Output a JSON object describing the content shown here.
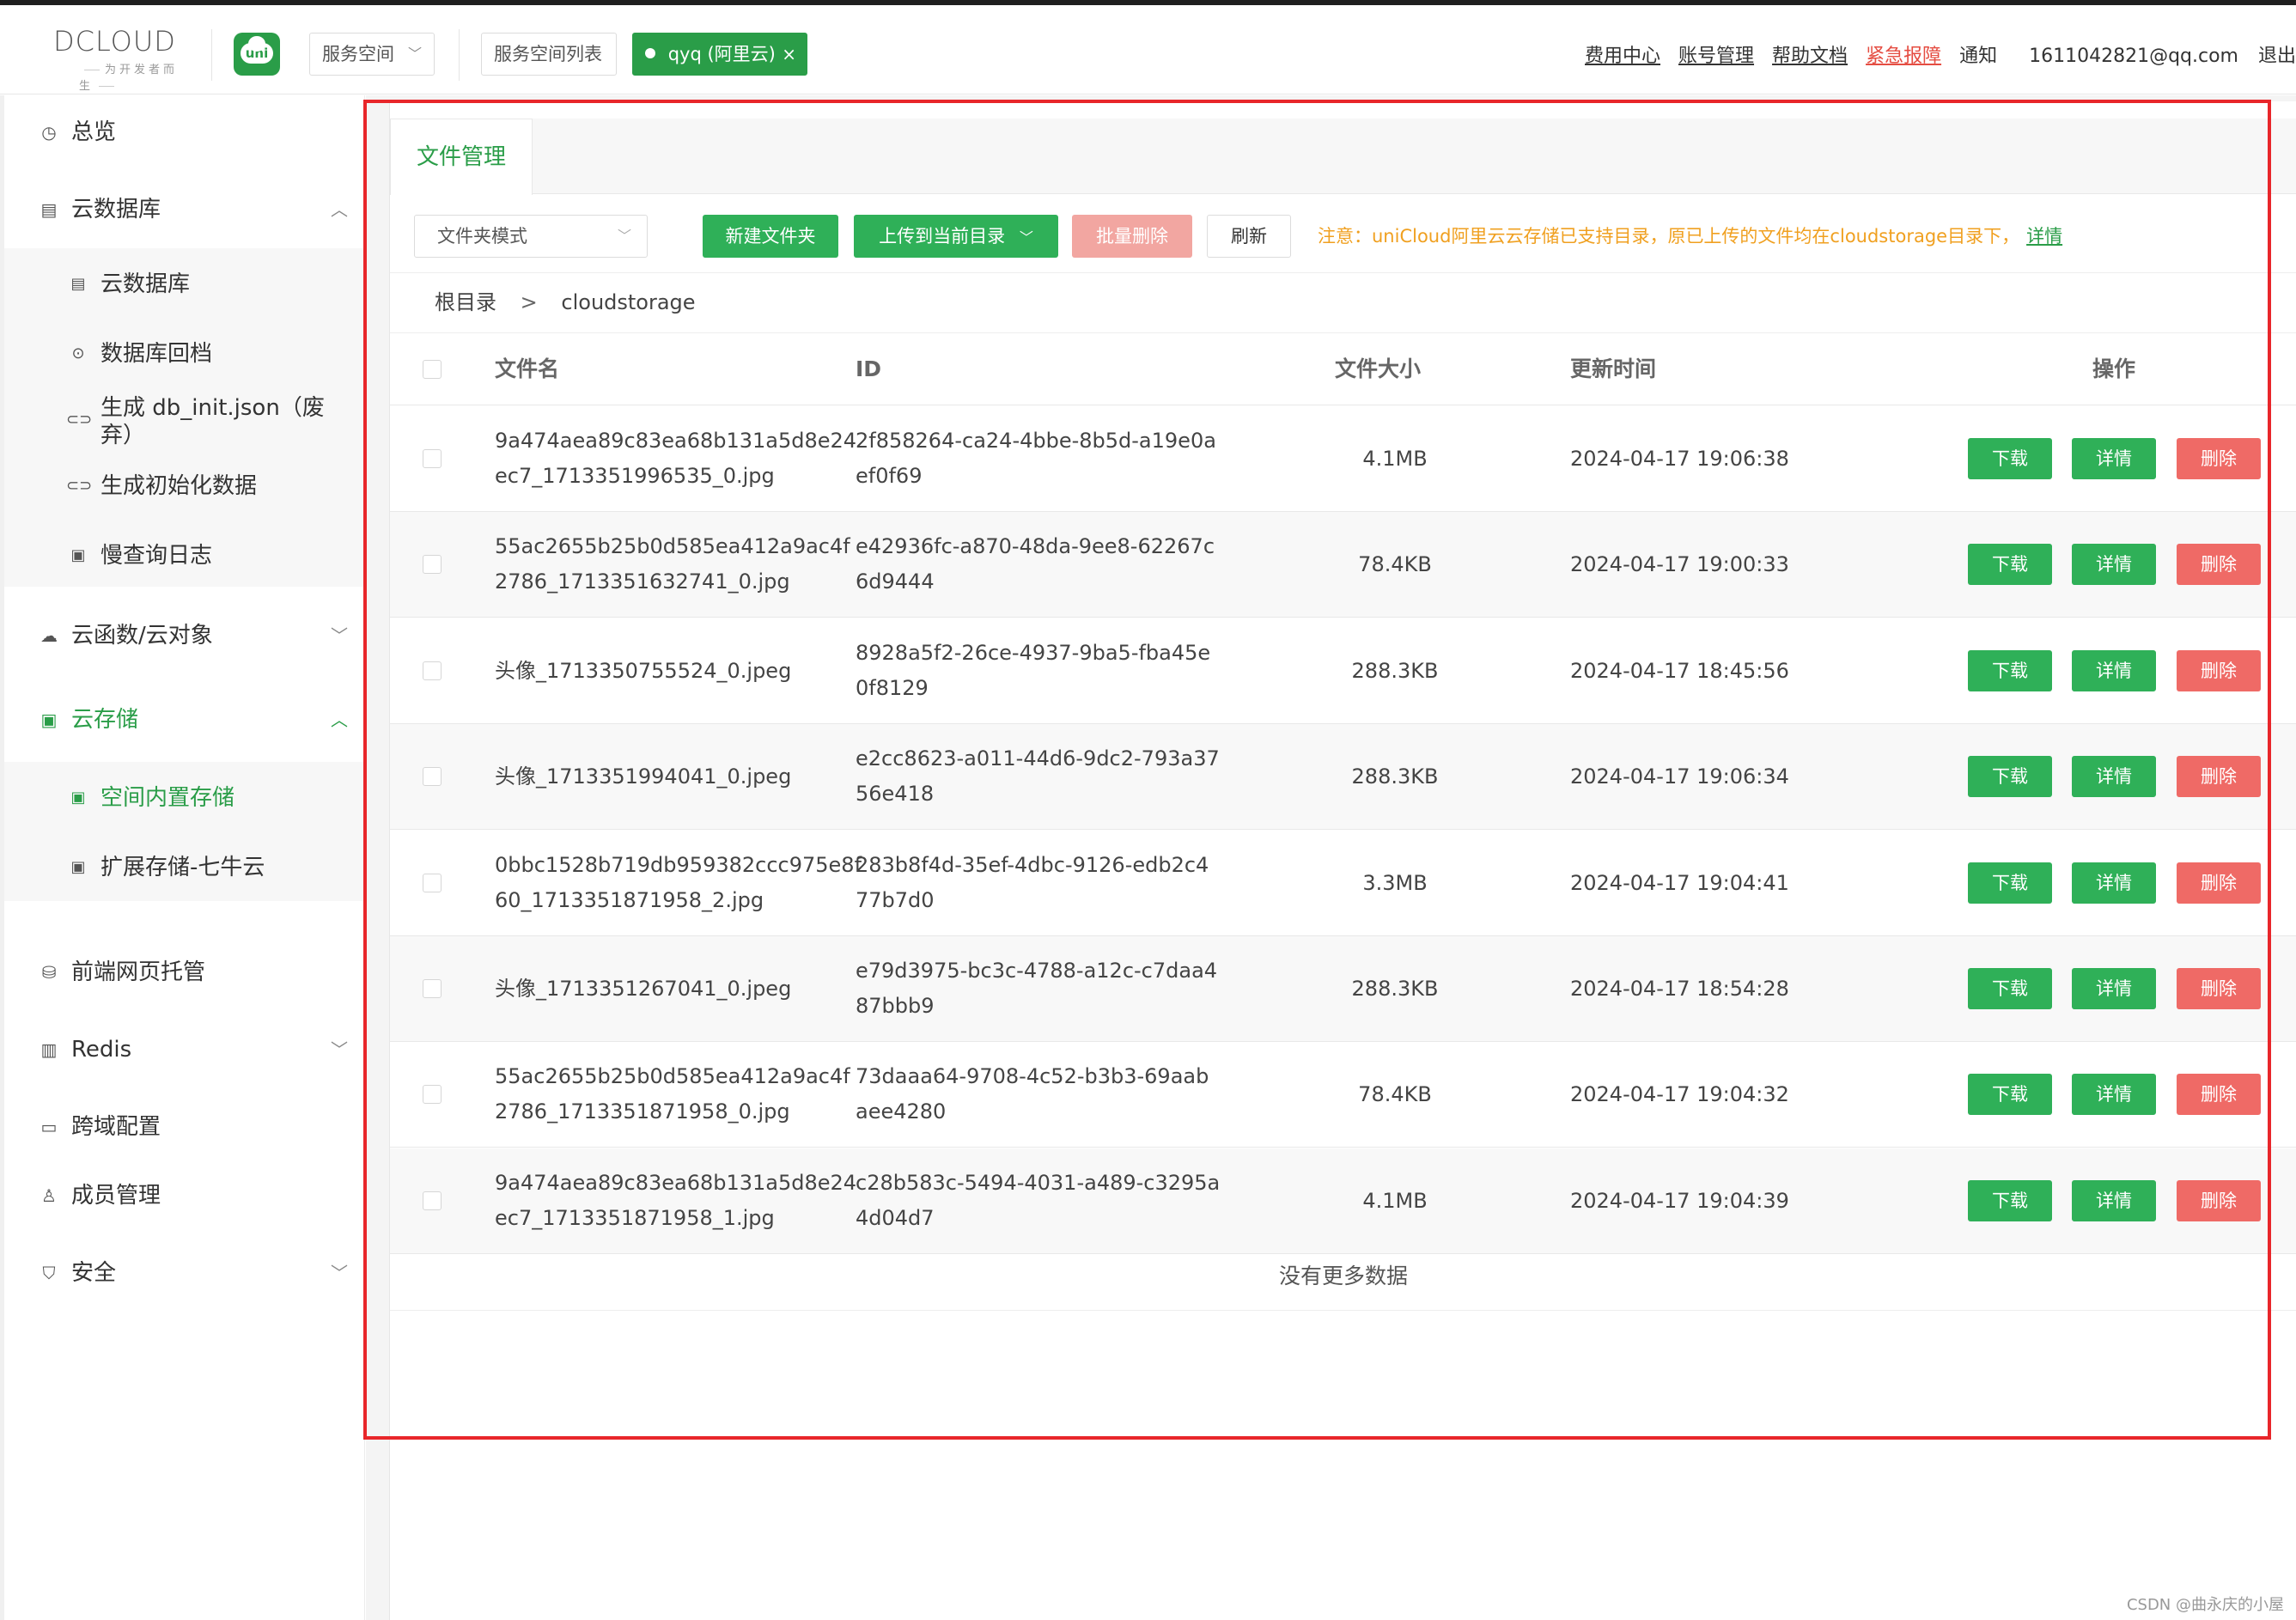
{
  "header": {
    "logo_text": "DCLOUD",
    "logo_tagline": "为开发者而生",
    "uni_badge": "uni",
    "space_dropdown": "服务空间",
    "space_list_tab": "服务空间列表",
    "active_space_tab": "qyq (阿里云)",
    "close_symbol": "×",
    "links": {
      "fee_center": "费用中心",
      "account": "账号管理",
      "help_docs": "帮助文档",
      "emergency": "紧急报障",
      "notice": "通知",
      "email": "1611042821@qq.com",
      "logout": "退出"
    }
  },
  "sidebar": {
    "overview": "总览",
    "cloud_db": "云数据库",
    "cloud_db_sub": {
      "db": "云数据库",
      "rollback": "数据库回档",
      "gen_init": "生成 db_init.json（废弃）",
      "gen_data": "生成初始化数据",
      "slow_log": "慢查询日志"
    },
    "cloud_func": "云函数/云对象",
    "cloud_storage": "云存储",
    "cloud_storage_sub": {
      "builtin": "空间内置存储",
      "qiniu": "扩展存储-七牛云"
    },
    "hosting": "前端网页托管",
    "redis": "Redis",
    "cors": "跨域配置",
    "members": "成员管理",
    "security": "安全"
  },
  "main": {
    "tab": "文件管理",
    "mode_select": "文件夹模式",
    "buttons": {
      "new_folder": "新建文件夹",
      "upload": "上传到当前目录",
      "batch_delete": "批量删除",
      "refresh": "刷新"
    },
    "notice": "注意：uniCloud阿里云云存储已支持目录，原已上传的文件均在cloudstorage目录下，",
    "notice_link": "详情",
    "breadcrumb": [
      "根目录",
      "cloudstorage"
    ],
    "breadcrumb_sep": ">",
    "columns": {
      "name": "文件名",
      "id": "ID",
      "size": "文件大小",
      "updated": "更新时间",
      "actions": "操作"
    },
    "row_actions": {
      "download": "下载",
      "detail": "详情",
      "delete": "删除"
    },
    "rows": [
      {
        "name1": "9a474aea89c83ea68b131a5d8e24",
        "name2": "ec7_1713351996535_0.jpg",
        "id1": "2f858264-ca24-4bbe-8b5d-a19e0a",
        "id2": "ef0f69",
        "size": "4.1MB",
        "time": "2024-04-17 19:06:38"
      },
      {
        "name1": "55ac2655b25b0d585ea412a9ac4f",
        "name2": "2786_1713351632741_0.jpg",
        "id1": "e42936fc-a870-48da-9ee8-62267c",
        "id2": "6d9444",
        "size": "78.4KB",
        "time": "2024-04-17 19:00:33"
      },
      {
        "name1": "头像_1713350755524_0.jpeg",
        "name2": "",
        "id1": "8928a5f2-26ce-4937-9ba5-fba45e",
        "id2": "0f8129",
        "size": "288.3KB",
        "time": "2024-04-17 18:45:56"
      },
      {
        "name1": "头像_1713351994041_0.jpeg",
        "name2": "",
        "id1": "e2cc8623-a011-44d6-9dc2-793a37",
        "id2": "56e418",
        "size": "288.3KB",
        "time": "2024-04-17 19:06:34"
      },
      {
        "name1": "0bbc1528b719db959382ccc975e8f",
        "name2": "60_1713351871958_2.jpg",
        "id1": "283b8f4d-35ef-4dbc-9126-edb2c4",
        "id2": "77b7d0",
        "size": "3.3MB",
        "time": "2024-04-17 19:04:41"
      },
      {
        "name1": "头像_1713351267041_0.jpeg",
        "name2": "",
        "id1": "e79d3975-bc3c-4788-a12c-c7daa4",
        "id2": "87bbb9",
        "size": "288.3KB",
        "time": "2024-04-17 18:54:28"
      },
      {
        "name1": "55ac2655b25b0d585ea412a9ac4f",
        "name2": "2786_1713351871958_0.jpg",
        "id1": "73daaa64-9708-4c52-b3b3-69aab",
        "id2": "aee4280",
        "size": "78.4KB",
        "time": "2024-04-17 19:04:32"
      },
      {
        "name1": "9a474aea89c83ea68b131a5d8e24",
        "name2": "ec7_1713351871958_1.jpg",
        "id1": "c28b583c-5494-4031-a489-c3295a",
        "id2": "4d04d7",
        "size": "4.1MB",
        "time": "2024-04-17 19:04:39"
      }
    ],
    "no_more": "没有更多数据"
  },
  "watermark": "CSDN @曲永庆的小屋",
  "colors": {
    "accent": "#2a9d48",
    "danger": "#ef6a66",
    "highlight_box": "#e8262a",
    "notice": "#f0a020"
  }
}
